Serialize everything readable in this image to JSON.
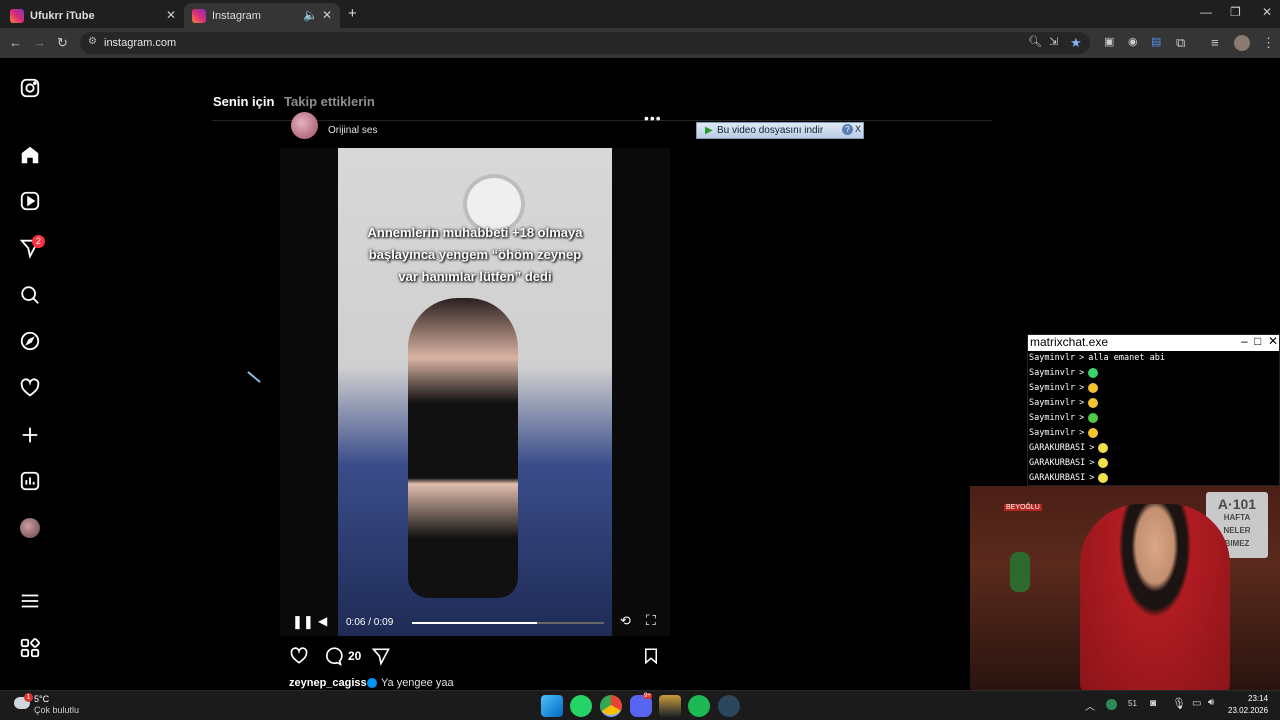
{
  "browser": {
    "tabs": [
      {
        "title": "Ufukrr iTube",
        "active": false
      },
      {
        "title": "Instagram",
        "active": true
      }
    ],
    "url": "instagram.com",
    "new_tab_symbol": "+"
  },
  "instagram": {
    "notification_count": "2",
    "feed_tabs": {
      "for_you": "Senin için",
      "following": "Takip ettiklerin"
    },
    "post": {
      "audio": "Orijinal ses",
      "overlay_caption_line1": "Annemlerin muhabbeti +18 olmaya",
      "overlay_caption_line2": "başlayınca yengem “öhöm zeynep",
      "overlay_caption_line3": "var hanımlar lütfen” dedi",
      "time": "0:06 / 0:09",
      "progress": 0.65,
      "comments": "20",
      "username": "zeynep_cagiss",
      "caption": "Ya yengee yaa"
    }
  },
  "download_bar": {
    "label": "Bu video dosyasını indir",
    "help": "?",
    "close": "X"
  },
  "chat_window": {
    "title": "matrixchat.exe",
    "lines": [
      {
        "user": "Sayminvlr",
        "sep": ">",
        "text": "alla emanet abi",
        "emoji_color": ""
      },
      {
        "user": "Sayminvlr",
        "sep": ">",
        "text": "",
        "emoji_color": "#3bd16f"
      },
      {
        "user": "Sayminvlr",
        "sep": ">",
        "text": "",
        "emoji_color": "#f2c230"
      },
      {
        "user": "Sayminvlr",
        "sep": ">",
        "text": "",
        "emoji_color": "#f2c230"
      },
      {
        "user": "Sayminvlr",
        "sep": ">",
        "text": "",
        "emoji_color": "#4ec94a"
      },
      {
        "user": "Sayminvlr",
        "sep": ">",
        "text": "",
        "emoji_color": "#f2c230"
      },
      {
        "user": "GARAKURBASI",
        "sep": ">",
        "text": "",
        "emoji_color": "#f2e04a"
      },
      {
        "user": "GARAKURBASI",
        "sep": ">",
        "text": "",
        "emoji_color": "#f2e04a"
      },
      {
        "user": "GARAKURBASI",
        "sep": ">",
        "text": "",
        "emoji_color": "#f2e04a"
      }
    ]
  },
  "webcam": {
    "wall_text_top": "A·101",
    "wall_text_lines": [
      "HAFTA",
      "NELER",
      "BIMEZ"
    ],
    "sign": "BEYOĞLU"
  },
  "taskbar": {
    "weather_temp": "5°C",
    "weather_desc": "Çok bulutlu",
    "weather_badge": "1",
    "tray_count": "51",
    "time": "23:14",
    "date": "23.02.2026",
    "discord_badge": "9+"
  },
  "colors": {
    "ig_notification": "#ff3040",
    "accent_blue": "#0095f6",
    "chrome_bg": "#1f1f1f"
  }
}
